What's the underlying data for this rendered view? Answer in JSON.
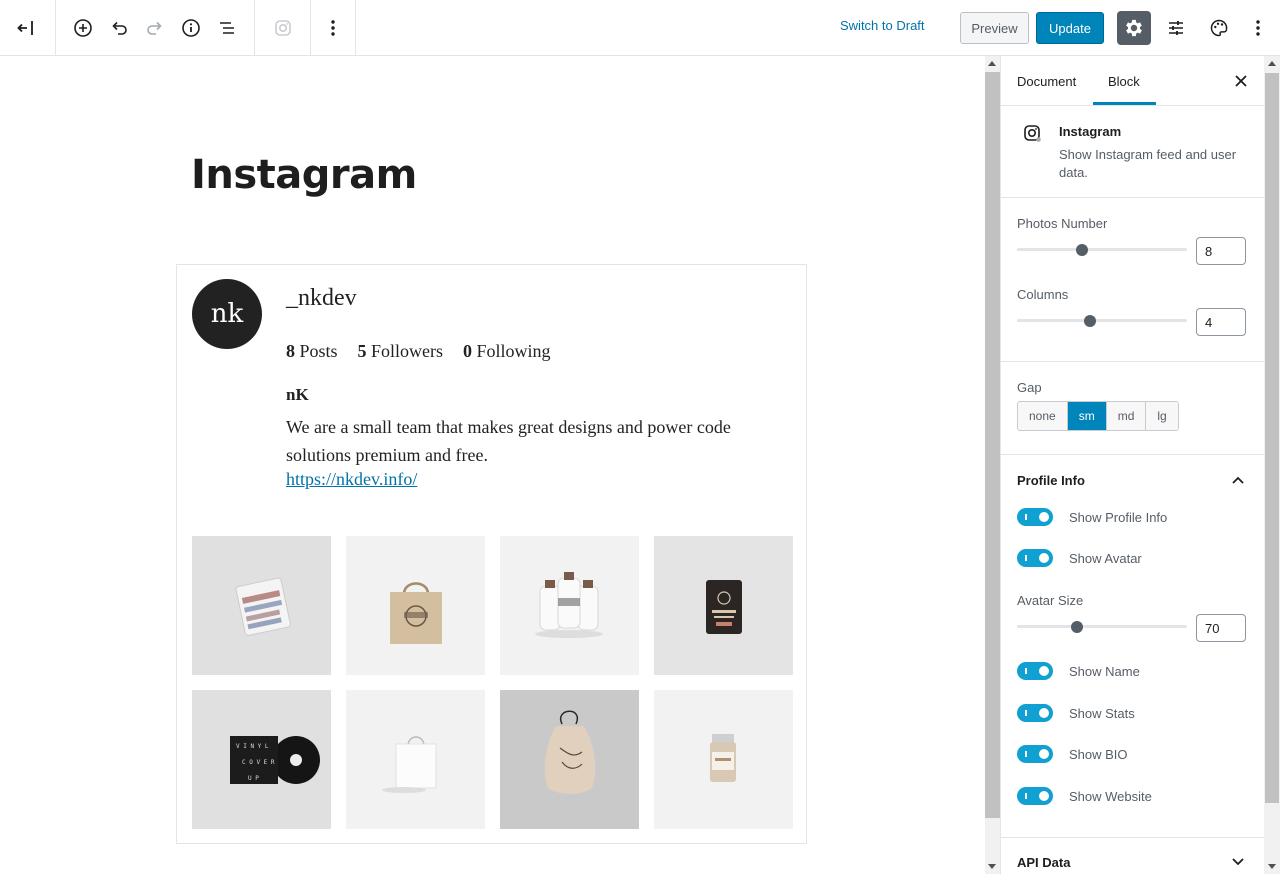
{
  "toolbar": {
    "switch_draft": "Switch to Draft",
    "preview": "Preview",
    "update": "Update",
    "icons": [
      "back-icon",
      "add-block-icon",
      "undo-icon",
      "redo-icon",
      "info-icon",
      "outline-icon",
      "instagram-block-icon",
      "more-vertical-icon",
      "gear-icon",
      "sliders-icon",
      "palette-icon",
      "more-vertical-icon"
    ]
  },
  "post": {
    "title": "Instagram"
  },
  "instagram": {
    "avatar_text": "nk",
    "username": "_nkdev",
    "posts_count": "8",
    "posts_label": "Posts",
    "followers_count": "5",
    "followers_label": "Followers",
    "following_count": "0",
    "following_label": "Following",
    "bio_name": "nK",
    "bio": "We are a small team that makes great designs and power code solutions premium and free.",
    "website": "https://nkdev.info/",
    "photos": [
      "tshirt",
      "tote-bag",
      "milk-bottles",
      "coffee-pouch",
      "vinyl-record",
      "shopping-bag",
      "drawstring-bag",
      "jar"
    ]
  },
  "sidebar": {
    "tabs": [
      {
        "label": "Document",
        "active": false
      },
      {
        "label": "Block",
        "active": true
      }
    ],
    "block": {
      "title": "Instagram",
      "description": "Show Instagram feed and user data."
    },
    "photos_number": {
      "label": "Photos Number",
      "value": "8",
      "fraction": 0.38
    },
    "columns": {
      "label": "Columns",
      "value": "4",
      "fraction": 0.43
    },
    "gap": {
      "label": "Gap",
      "options": [
        "none",
        "sm",
        "md",
        "lg"
      ],
      "selected": "sm"
    },
    "profile_info": {
      "title": "Profile Info",
      "toggles": [
        {
          "label": "Show Profile Info",
          "on": true
        },
        {
          "label": "Show Avatar",
          "on": true
        }
      ],
      "avatar_size": {
        "label": "Avatar Size",
        "value": "70",
        "fraction": 0.35
      },
      "toggles2": [
        {
          "label": "Show Name",
          "on": true
        },
        {
          "label": "Show Stats",
          "on": true
        },
        {
          "label": "Show BIO",
          "on": true
        },
        {
          "label": "Show Website",
          "on": true
        }
      ]
    },
    "api_data": {
      "title": "API Data"
    }
  },
  "colors": {
    "accent": "#0085ba",
    "toggle": "#11a0d2",
    "link": "#0073aa"
  }
}
